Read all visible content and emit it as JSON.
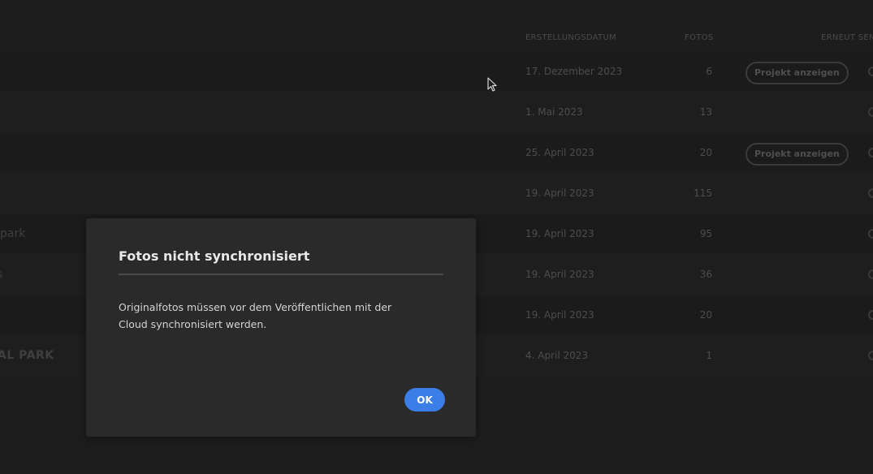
{
  "table": {
    "headers": {
      "created": "ERSTELLUNGSDATUM",
      "photos": "FOTOS",
      "resend": "ERNEUT SEN"
    },
    "rows": [
      {
        "name": "",
        "date": "17. Dezember 2023",
        "count": "6",
        "action": "Projekt anzeigen"
      },
      {
        "name": "",
        "date": "1. Mai 2023",
        "count": "13",
        "action": ""
      },
      {
        "name": "",
        "date": "25. April 2023",
        "count": "20",
        "action": "Projekt anzeigen"
      },
      {
        "name": "",
        "date": "19. April 2023",
        "count": "115",
        "action": ""
      },
      {
        "name": "park",
        "date": "19. April 2023",
        "count": "95",
        "action": ""
      },
      {
        "name": "s",
        "date": "19. April 2023",
        "count": "36",
        "action": ""
      },
      {
        "name": "",
        "date": "19. April 2023",
        "count": "20",
        "action": ""
      },
      {
        "name": "AL PARK",
        "date": "4. April 2023",
        "count": "1",
        "action": ""
      }
    ]
  },
  "dialog": {
    "title": "Fotos nicht synchronisiert",
    "message": "Originalfotos müssen vor dem Veröffentlichen mit der Cloud synchronisiert werden.",
    "ok_label": "OK"
  },
  "colors": {
    "accent": "#3c7ee8",
    "dialog_bg": "#2a2a2a",
    "page_bg": "#1d1d1d"
  }
}
